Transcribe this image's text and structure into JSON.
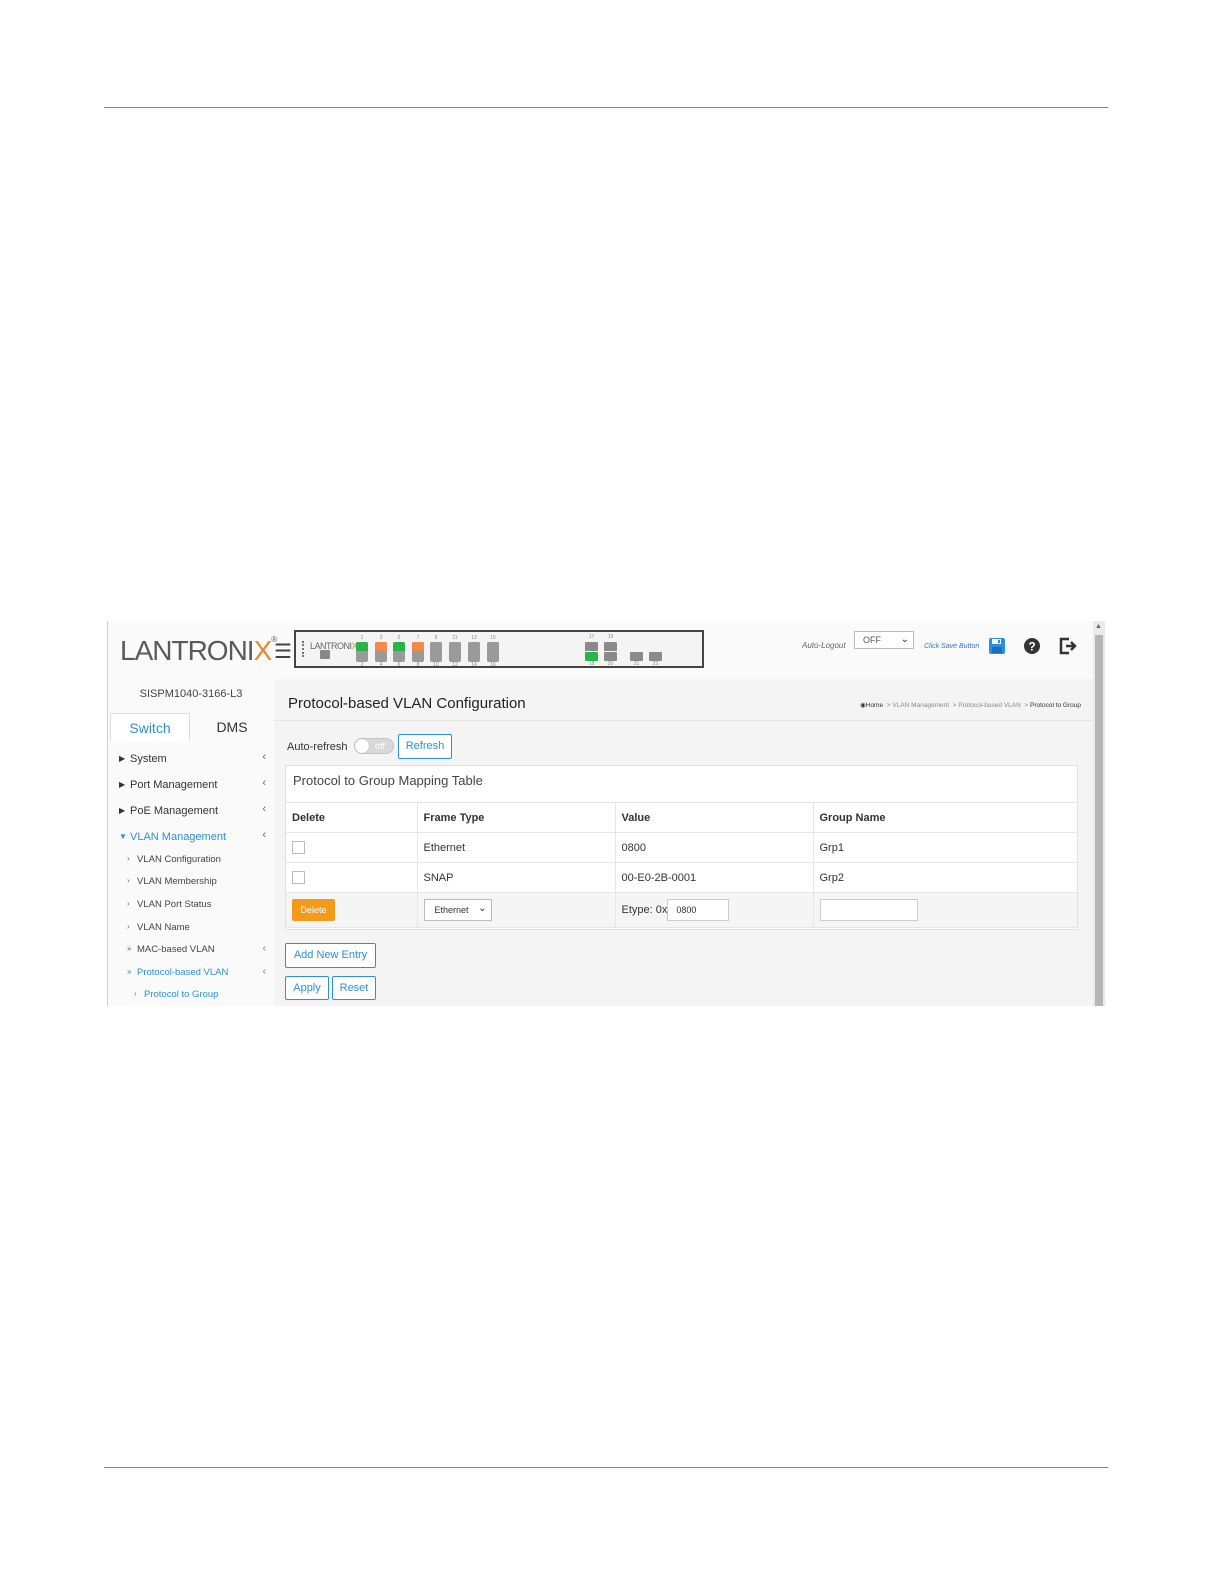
{
  "header": {
    "logo_text": "LANTRONIX",
    "logo_reg": "®",
    "panel_logo_text": "LANTRONIX",
    "port_top_numbers": [
      "1",
      "3",
      "5",
      "7",
      "9",
      "11",
      "13",
      "15"
    ],
    "port_bottom_numbers": [
      "2",
      "4",
      "6",
      "8",
      "10",
      "12",
      "14",
      "16"
    ],
    "sfp_top_numbers": [
      "17",
      "19"
    ],
    "sfp_bottom_numbers": [
      "18",
      "20",
      "21",
      "22"
    ],
    "auto_logout_label": "Auto-Logout",
    "auto_logout_value": "OFF",
    "save_hint": "Click Save Button",
    "colors": {
      "accent": "#2b8fe0",
      "link_up": "#29b34a",
      "poe": "#f08a4b",
      "delete_button": "#f39a1b"
    }
  },
  "sidebar": {
    "device_name": "SISPM1040-3166-L3",
    "tabs": [
      {
        "label": "Switch",
        "active": true
      },
      {
        "label": "DMS",
        "active": false
      }
    ],
    "items": [
      {
        "label": "System"
      },
      {
        "label": "Port Management"
      },
      {
        "label": "PoE Management"
      },
      {
        "label": "VLAN Management"
      }
    ],
    "sub_items": [
      {
        "label": "VLAN Configuration"
      },
      {
        "label": "VLAN Membership"
      },
      {
        "label": "VLAN Port Status"
      },
      {
        "label": "VLAN Name"
      },
      {
        "label": "MAC-based VLAN"
      },
      {
        "label": "Protocol-based VLAN"
      },
      {
        "label": "Protocol to Group"
      }
    ]
  },
  "main": {
    "title": "Protocol-based VLAN Configuration",
    "breadcrumb": [
      "Home",
      "VLAN Management",
      "Protocol-based VLAN",
      "Protocol to Group"
    ],
    "auto_refresh_label": "Auto-refresh",
    "auto_refresh_state": "off",
    "refresh_label": "Refresh",
    "table": {
      "title": "Protocol to Group Mapping Table",
      "columns": [
        "Delete",
        "Frame Type",
        "Value",
        "Group Name"
      ],
      "rows": [
        {
          "frame_type": "Ethernet",
          "value": "0800",
          "group_name": "Grp1"
        },
        {
          "frame_type": "SNAP",
          "value": "00-E0-2B-0001",
          "group_name": "Grp2"
        }
      ],
      "new_row": {
        "delete_label": "Delete",
        "frame_type_selected": "Ethernet",
        "etype_label": "Etype: 0x",
        "etype_value": "0800",
        "group_name_value": ""
      }
    },
    "add_new_entry_label": "Add New Entry",
    "apply_label": "Apply",
    "reset_label": "Reset"
  }
}
